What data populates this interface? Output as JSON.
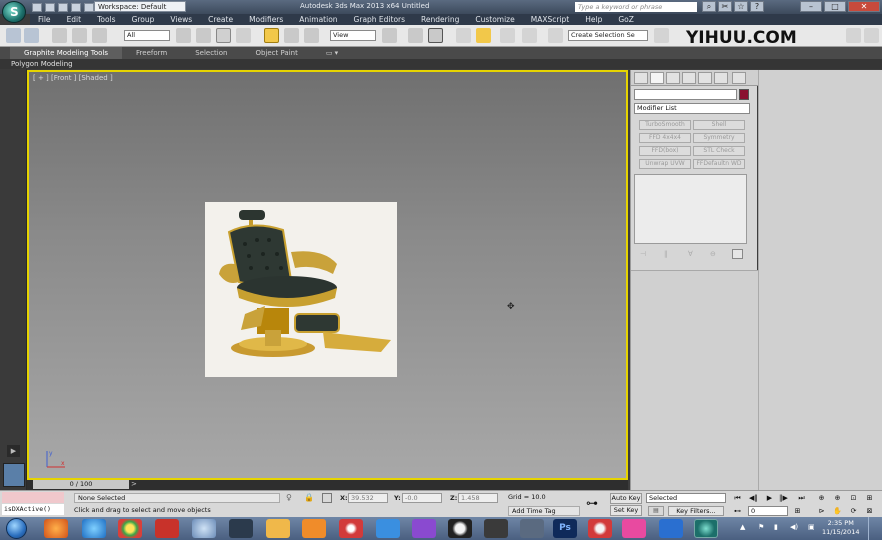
{
  "title_bar": {
    "workspace": "Workspace: Default",
    "window_title": "Autodesk 3ds Max 2013 x64      Untitled",
    "search_placeholder": "Type a keyword or phrase",
    "app_logo": "S"
  },
  "menu": {
    "items": [
      "File",
      "Edit",
      "Tools",
      "Group",
      "Views",
      "Create",
      "Modifiers",
      "Animation",
      "Graph Editors",
      "Rendering",
      "Customize",
      "MAXScript",
      "Help",
      "GoZ"
    ]
  },
  "toolbar": {
    "selection_filter": "All",
    "reference_coord": "View",
    "named_selection_placeholder": "Create Selection Se",
    "watermark": "YIHUU.COM"
  },
  "ribbon": {
    "tabs": [
      "Graphite Modeling Tools",
      "Freeform",
      "Selection",
      "Object Paint"
    ],
    "active_tab": "Graphite Modeling Tools",
    "panel_label": "Polygon Modeling"
  },
  "viewport": {
    "label": "[ + ] [Front ] [Shaded ]",
    "axis_labels": {
      "y": "y",
      "x": "x"
    },
    "image_subject": "antique barber chair"
  },
  "command_panel": {
    "modifier_list": "Modifier List",
    "modifier_buttons": [
      [
        "TurboSmooth",
        "Shell"
      ],
      [
        "FFD 4x4x4",
        "Symmetry"
      ],
      [
        "FFD(box)",
        "STL Check"
      ],
      [
        "Unwrap UVW",
        "FFDefaultn WD"
      ]
    ],
    "object_color": "#8a1030"
  },
  "time_slider": {
    "label": "0 / 100"
  },
  "status": {
    "listener_text": "isDXActive()",
    "selection": "None Selected",
    "prompt": "Click and drag to select and move objects",
    "x_label": "X:",
    "x_value": "39.532",
    "y_label": "Y:",
    "y_value": "-0.0",
    "z_label": "Z:",
    "z_value": "1.458",
    "grid": "Grid = 10.0",
    "add_time_tag": "Add Time Tag",
    "auto_key": "Auto Key",
    "set_key": "Set Key",
    "selected_dropdown": "Selected",
    "key_filters": "Key Filters...",
    "frame": "0"
  },
  "taskbar": {
    "clock_time": "2:35 PM",
    "clock_date": "11/15/2014"
  }
}
